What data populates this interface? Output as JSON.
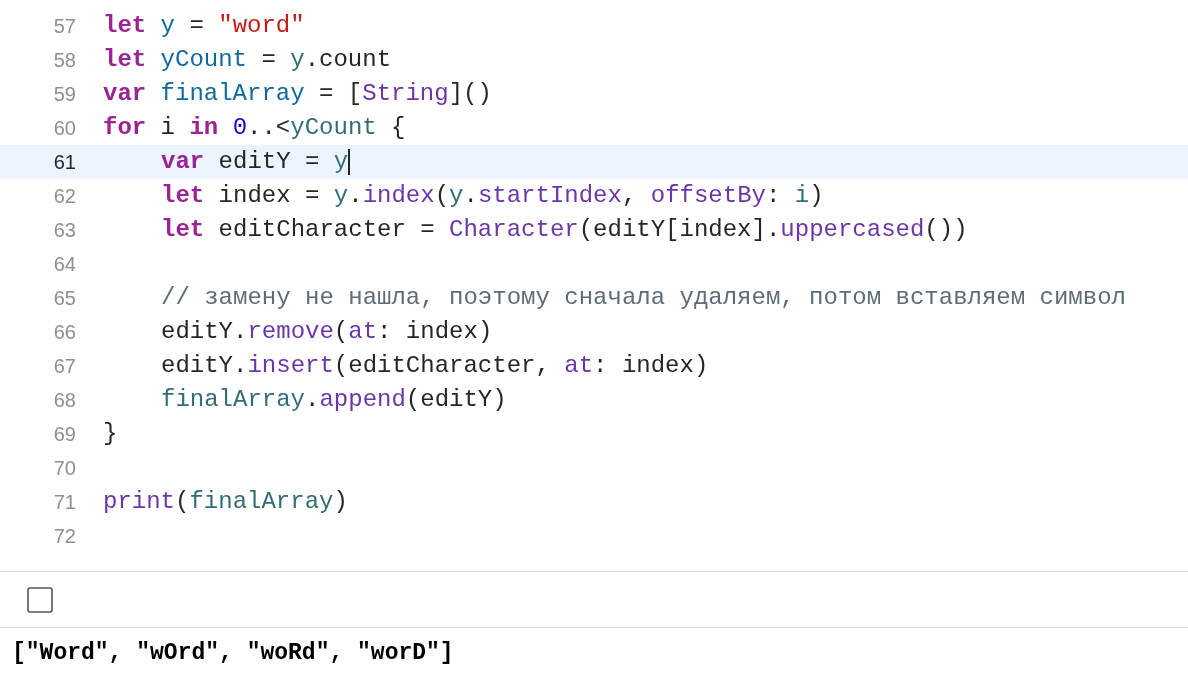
{
  "editor": {
    "lines": [
      {
        "number": "57",
        "current": false,
        "indented": false,
        "tokens": [
          {
            "kind": "keyword",
            "text": "let "
          },
          {
            "kind": "declaration",
            "text": "y"
          },
          {
            "kind": "plain",
            "text": " = "
          },
          {
            "kind": "string",
            "text": "\"word\""
          }
        ]
      },
      {
        "number": "58",
        "current": false,
        "indented": false,
        "tokens": [
          {
            "kind": "keyword",
            "text": "let "
          },
          {
            "kind": "declaration",
            "text": "yCount"
          },
          {
            "kind": "plain",
            "text": " = "
          },
          {
            "kind": "reference",
            "text": "y"
          },
          {
            "kind": "plain",
            "text": ".count"
          }
        ]
      },
      {
        "number": "59",
        "current": false,
        "indented": false,
        "tokens": [
          {
            "kind": "keyword",
            "text": "var "
          },
          {
            "kind": "declaration",
            "text": "finalArray"
          },
          {
            "kind": "plain",
            "text": " = ["
          },
          {
            "kind": "api",
            "text": "String"
          },
          {
            "kind": "plain",
            "text": "]()"
          }
        ]
      },
      {
        "number": "60",
        "current": false,
        "indented": false,
        "tokens": [
          {
            "kind": "keyword",
            "text": "for"
          },
          {
            "kind": "plain",
            "text": " i "
          },
          {
            "kind": "keyword",
            "text": "in "
          },
          {
            "kind": "number",
            "text": "0"
          },
          {
            "kind": "plain",
            "text": "..<"
          },
          {
            "kind": "reference",
            "text": "yCount"
          },
          {
            "kind": "plain",
            "text": " {"
          }
        ]
      },
      {
        "number": "61",
        "current": true,
        "indented": true,
        "tokens": [
          {
            "kind": "keyword",
            "text": "var"
          },
          {
            "kind": "plain",
            "text": " editY = "
          },
          {
            "kind": "reference",
            "text": "y"
          }
        ]
      },
      {
        "number": "62",
        "current": false,
        "indented": true,
        "tokens": [
          {
            "kind": "keyword",
            "text": "let"
          },
          {
            "kind": "plain",
            "text": " index = "
          },
          {
            "kind": "reference",
            "text": "y"
          },
          {
            "kind": "plain",
            "text": "."
          },
          {
            "kind": "api",
            "text": "index"
          },
          {
            "kind": "plain",
            "text": "("
          },
          {
            "kind": "reference",
            "text": "y"
          },
          {
            "kind": "plain",
            "text": "."
          },
          {
            "kind": "api",
            "text": "startIndex"
          },
          {
            "kind": "plain",
            "text": ", "
          },
          {
            "kind": "api",
            "text": "offsetBy"
          },
          {
            "kind": "plain",
            "text": ": "
          },
          {
            "kind": "reference",
            "text": "i"
          },
          {
            "kind": "plain",
            "text": ")"
          }
        ]
      },
      {
        "number": "63",
        "current": false,
        "indented": true,
        "tokens": [
          {
            "kind": "keyword",
            "text": "let"
          },
          {
            "kind": "plain",
            "text": " editCharacter = "
          },
          {
            "kind": "api",
            "text": "Character"
          },
          {
            "kind": "plain",
            "text": "(editY[index]."
          },
          {
            "kind": "api",
            "text": "uppercased"
          },
          {
            "kind": "plain",
            "text": "())"
          }
        ]
      },
      {
        "number": "64",
        "current": false
      },
      {
        "number": "65",
        "current": false,
        "indented": true,
        "tokens": [
          {
            "kind": "comment",
            "text": "// замену не нашла, поэтому сначала удаляем, потом вставляем символ"
          }
        ]
      },
      {
        "number": "66",
        "current": false,
        "indented": true,
        "tokens": [
          {
            "kind": "plain",
            "text": "editY."
          },
          {
            "kind": "api",
            "text": "remove"
          },
          {
            "kind": "plain",
            "text": "("
          },
          {
            "kind": "api",
            "text": "at"
          },
          {
            "kind": "plain",
            "text": ": index)"
          }
        ]
      },
      {
        "number": "67",
        "current": false,
        "indented": true,
        "tokens": [
          {
            "kind": "plain",
            "text": "editY."
          },
          {
            "kind": "api",
            "text": "insert"
          },
          {
            "kind": "plain",
            "text": "(editCharacter, "
          },
          {
            "kind": "api",
            "text": "at"
          },
          {
            "kind": "plain",
            "text": ": index)"
          }
        ]
      },
      {
        "number": "68",
        "current": false,
        "indented": true,
        "tokens": [
          {
            "kind": "reference",
            "text": "finalArray"
          },
          {
            "kind": "plain",
            "text": "."
          },
          {
            "kind": "api",
            "text": "append"
          },
          {
            "kind": "plain",
            "text": "(editY)"
          }
        ]
      },
      {
        "number": "69",
        "current": false,
        "indented": false,
        "tokens": [
          {
            "kind": "plain",
            "text": "}"
          }
        ]
      },
      {
        "number": "70",
        "current": false
      },
      {
        "number": "71",
        "current": false,
        "indented": false,
        "tokens": [
          {
            "kind": "api",
            "text": "print"
          },
          {
            "kind": "plain",
            "text": "("
          },
          {
            "kind": "reference",
            "text": "finalArray"
          },
          {
            "kind": "plain",
            "text": ")"
          }
        ]
      },
      {
        "number": "72",
        "current": false
      }
    ]
  },
  "console": {
    "output": "[\"Word\", \"wOrd\", \"woRd\", \"worD\"]"
  }
}
